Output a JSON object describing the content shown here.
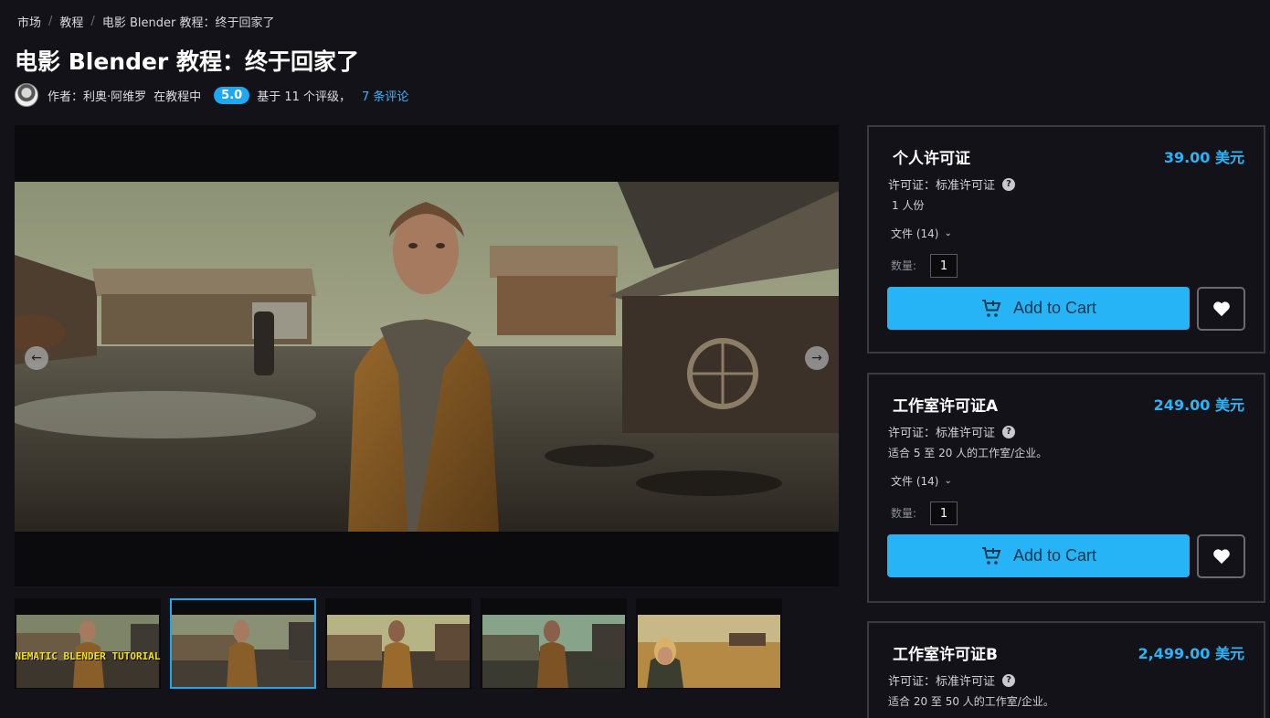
{
  "breadcrumb": [
    "市场",
    "教程",
    "电影 Blender 教程：终于回家了"
  ],
  "title": "电影 Blender 教程：终于回家了",
  "meta": {
    "author_text": "作者：利奥·阿维罗",
    "category_text": "在教程中",
    "rating": "5.0",
    "rating_text": "基于 11 个评级，",
    "reviews_link": "7 条评论"
  },
  "gallery": {
    "prev_icon": "arrow-left-icon",
    "next_icon": "arrow-right-icon",
    "thumbnail_caption": "NEMATIC BLENDER TUTORIAL",
    "active_thumbnail": 2,
    "thumbnail_count": 5
  },
  "licenses": [
    {
      "name": "个人许可证",
      "price": "39.00 美元",
      "license_type": "许可证：标准许可证",
      "description": "1 人份",
      "files": "文件 (14)",
      "qty_label": "数量:",
      "qty": "1",
      "cart_label": "Add to Cart"
    },
    {
      "name": "工作室许可证A",
      "price": "249.00 美元",
      "license_type": "许可证：标准许可证",
      "description": "适合 5 至 20 人的工作室/企业。",
      "files": "文件 (14)",
      "qty_label": "数量:",
      "qty": "1",
      "cart_label": "Add to Cart"
    },
    {
      "name": "工作室许可证B",
      "price": "2,499.00 美元",
      "license_type": "许可证：标准许可证",
      "description": "适合 20 至 50 人的工作室/企业。"
    }
  ],
  "colors": {
    "accent": "#27b4f7",
    "background": "#121218",
    "link": "#3ab4ff"
  }
}
